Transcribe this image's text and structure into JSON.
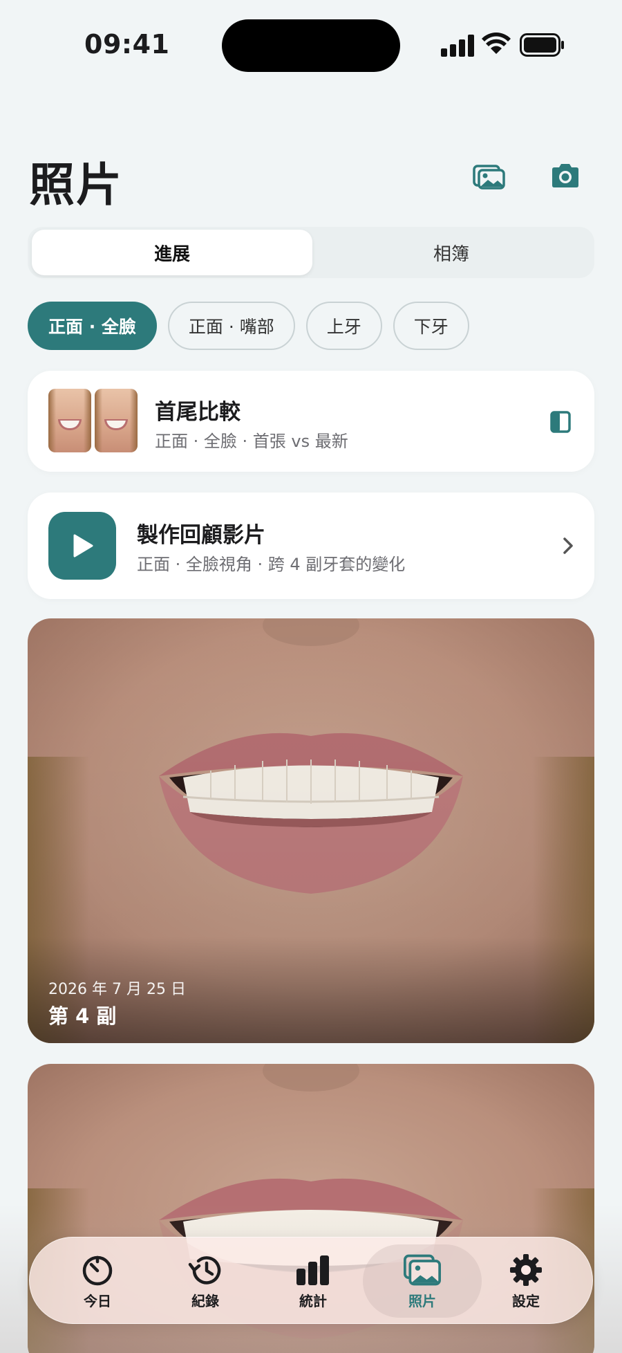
{
  "status_bar": {
    "time": "09:41"
  },
  "header": {
    "title": "照片",
    "icons": [
      "photo-library-icon",
      "camera-icon"
    ]
  },
  "segment": {
    "items": [
      {
        "label": "進展",
        "active": true
      },
      {
        "label": "相簿",
        "active": false
      }
    ]
  },
  "filters": {
    "chips": [
      {
        "label": "正面 · 全臉",
        "active": true
      },
      {
        "label": "正面 · 嘴部",
        "active": false
      },
      {
        "label": "上牙",
        "active": false
      },
      {
        "label": "下牙",
        "active": false
      }
    ]
  },
  "compare_card": {
    "title": "首尾比較",
    "subtitle": "正面 · 全臉 · 首張 vs 最新",
    "icon": "split-view-icon"
  },
  "video_card": {
    "title": "製作回顧影片",
    "subtitle": "正面 · 全臉視角 · 跨 4 副牙套的變化",
    "icon": "play-icon"
  },
  "photos": [
    {
      "date": "2026 年 7 月 25 日",
      "label": "第 4 副"
    },
    {
      "date": "",
      "label": ""
    }
  ],
  "tabbar": {
    "items": [
      {
        "label": "今日",
        "icon": "timer-icon",
        "active": false
      },
      {
        "label": "紀錄",
        "icon": "history-icon",
        "active": false
      },
      {
        "label": "統計",
        "icon": "bar-chart-icon",
        "active": false
      },
      {
        "label": "照片",
        "icon": "photos-icon",
        "active": true
      },
      {
        "label": "設定",
        "icon": "gear-icon",
        "active": false
      }
    ]
  },
  "colors": {
    "accent": "#2d7a7b",
    "background": "#f1f5f6"
  }
}
